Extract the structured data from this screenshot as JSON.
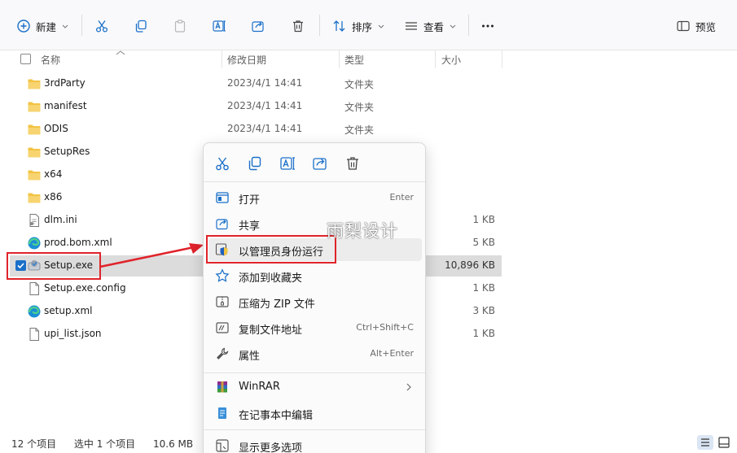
{
  "toolbar": {
    "new_label": "新建",
    "sort_label": "排序",
    "view_label": "查看",
    "preview_label": "预览",
    "icons": [
      "plus-circle-icon",
      "cut-icon",
      "copy-icon",
      "paste-icon",
      "rename-icon",
      "share-icon",
      "delete-icon",
      "sort-icon",
      "view-icon",
      "more-icon",
      "preview-pane-icon"
    ]
  },
  "columns": {
    "name": "名称",
    "date": "修改日期",
    "type": "类型",
    "size": "大小"
  },
  "files": [
    {
      "name": "3rdParty",
      "date": "2023/4/1 14:41",
      "type": "文件夹",
      "size": "",
      "icon": "folder-icon"
    },
    {
      "name": "manifest",
      "date": "2023/4/1 14:41",
      "type": "文件夹",
      "size": "",
      "icon": "folder-icon"
    },
    {
      "name": "ODIS",
      "date": "2023/4/1 14:41",
      "type": "文件夹",
      "size": "",
      "icon": "folder-icon"
    },
    {
      "name": "SetupRes",
      "date": "",
      "type": "",
      "size": "",
      "icon": "folder-icon"
    },
    {
      "name": "x64",
      "date": "",
      "type": "",
      "size": "",
      "icon": "folder-icon"
    },
    {
      "name": "x86",
      "date": "",
      "type": "",
      "size": "",
      "icon": "folder-icon"
    },
    {
      "name": "dlm.ini",
      "date": "",
      "type": "",
      "size": "1 KB",
      "icon": "ini-file-icon"
    },
    {
      "name": "prod.bom.xml",
      "date": "",
      "type": "",
      "size": "5 KB",
      "icon": "edge-icon"
    },
    {
      "name": "Setup.exe",
      "date": "",
      "type": "",
      "size": "10,896 KB",
      "icon": "setup-exe-icon"
    },
    {
      "name": "Setup.exe.config",
      "date": "",
      "type": "",
      "size": "1 KB",
      "icon": "file-icon"
    },
    {
      "name": "setup.xml",
      "date": "",
      "type": "",
      "size": "3 KB",
      "icon": "edge-icon"
    },
    {
      "name": "upi_list.json",
      "date": "",
      "type": "",
      "size": "1 KB",
      "icon": "file-icon"
    }
  ],
  "context_menu": {
    "quick_actions": [
      "cut-icon",
      "copy-icon",
      "rename-icon",
      "share-icon",
      "delete-icon"
    ],
    "items": [
      {
        "label": "打开",
        "shortcut": "Enter",
        "icon": "open-icon"
      },
      {
        "label": "共享",
        "shortcut": "",
        "icon": "share-icon"
      },
      {
        "label": "以管理员身份运行",
        "shortcut": "",
        "icon": "admin-shield-icon"
      },
      {
        "label": "添加到收藏夹",
        "shortcut": "",
        "icon": "star-icon"
      },
      {
        "label": "压缩为 ZIP 文件",
        "shortcut": "",
        "icon": "zip-icon"
      },
      {
        "label": "复制文件地址",
        "shortcut": "Ctrl+Shift+C",
        "icon": "copy-path-icon"
      },
      {
        "label": "属性",
        "shortcut": "Alt+Enter",
        "icon": "wrench-icon"
      },
      {
        "label": "WinRAR",
        "shortcut": "",
        "icon": "winrar-icon"
      },
      {
        "label": "在记事本中编辑",
        "shortcut": "",
        "icon": "notepad-icon"
      },
      {
        "label": "显示更多选项",
        "shortcut": "",
        "icon": "more-options-icon"
      }
    ]
  },
  "watermark": "雨梨设计",
  "status": {
    "count": "12 个项目",
    "selected": "选中 1 个项目",
    "size": "10.6 MB"
  },
  "colors": {
    "accent": "#1a6fc9",
    "highlight": "#e0232b",
    "folder": "#f2c343"
  }
}
